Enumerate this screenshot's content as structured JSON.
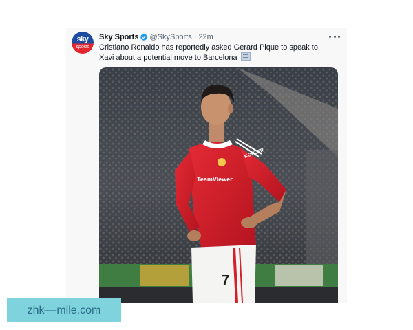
{
  "tweet": {
    "display_name": "Sky Sports",
    "handle": "@SkySports",
    "separator": "·",
    "time": "22m",
    "text": "Cristiano Ronaldo has reportedly asked Gerard Pique to speak to Xavi about a potential move to Barcelona",
    "avatar_logo_top": "sky",
    "avatar_logo_bottom": "sports",
    "photo": {
      "shirt_sponsor": "TeamViewer",
      "sleeve_sponsor": "KOHLER",
      "shorts_number": "7"
    }
  },
  "watermark": {
    "text": "zhk––mile.com"
  },
  "colors": {
    "verified": "#1d9bf0",
    "shirt_red": "#d4202c",
    "watermark_bg": "#7fd3dc"
  }
}
